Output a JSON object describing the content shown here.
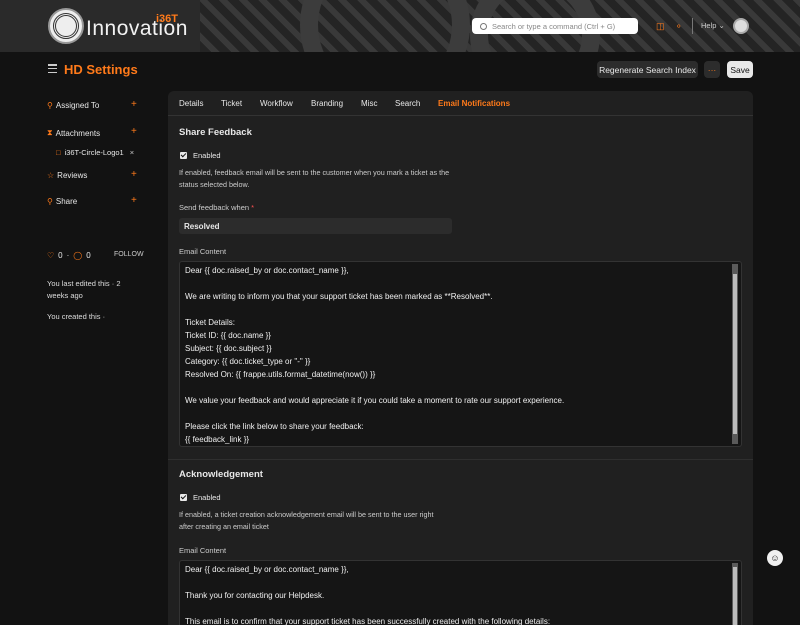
{
  "header": {
    "logo_text": "Innovation",
    "logo_mark": "i36T",
    "search_placeholder": "Search or type a command (Ctrl + G)",
    "help_label": "Help",
    "icons": [
      "search-icon",
      "chat-icon",
      "bell-icon",
      "avatar"
    ]
  },
  "page": {
    "title": "HD Settings",
    "regen_button": "Regenerate Search Index",
    "more_button": "···",
    "save_button": "Save"
  },
  "sidebar": {
    "assigned_to": "Assigned To",
    "attachments": "Attachments",
    "attachment_file": "i36T-Circle-Logo1",
    "reviews": "Reviews",
    "share": "Share",
    "likes": "0",
    "comments": "0",
    "follow": "FOLLOW",
    "edited": "You last edited this · 2 weeks ago",
    "created": "You created this ·"
  },
  "tabs": [
    "Details",
    "Ticket",
    "Workflow",
    "Branding",
    "Misc",
    "Search",
    "Email Notifications"
  ],
  "active_tab": "Email Notifications",
  "share_feedback": {
    "title": "Share Feedback",
    "enabled_label": "Enabled",
    "description": "If enabled, feedback email will be sent to the customer when you mark a ticket as the status selected below.",
    "send_when_label": "Send feedback when",
    "send_when_value": "Resolved",
    "content_label": "Email Content",
    "lines": [
      "Dear {{ doc.raised_by or doc.contact_name }},",
      "",
      "We are writing to inform you that your support ticket has been marked as **Resolved**.",
      "",
      "Ticket Details:",
      "Ticket ID: {{ doc.name }}",
      "Subject: {{ doc.subject }}",
      "Category: {{ doc.ticket_type or \"-\" }}",
      "Resolved On: {{ frappe.utils.format_datetime(now()) }}",
      "",
      "We value your feedback and would appreciate it if you could take a moment to rate our support experience.",
      "",
      "Please click the link below to share your feedback:",
      "{{ feedback_link }}"
    ]
  },
  "acknowledgement": {
    "title": "Acknowledgement",
    "enabled_label": "Enabled",
    "description": "If enabled, a ticket creation acknowledgement email will be sent to the user right after creating an email ticket",
    "content_label": "Email Content",
    "lines": [
      "Dear {{ doc.raised_by or doc.contact_name }},",
      "",
      "Thank you for contacting our Helpdesk.",
      "",
      "This email is to confirm that your support ticket has been successfully created with the following details:"
    ]
  },
  "colors": {
    "accent": "#ff7a1a",
    "background": "#121212",
    "card": "#202020"
  }
}
